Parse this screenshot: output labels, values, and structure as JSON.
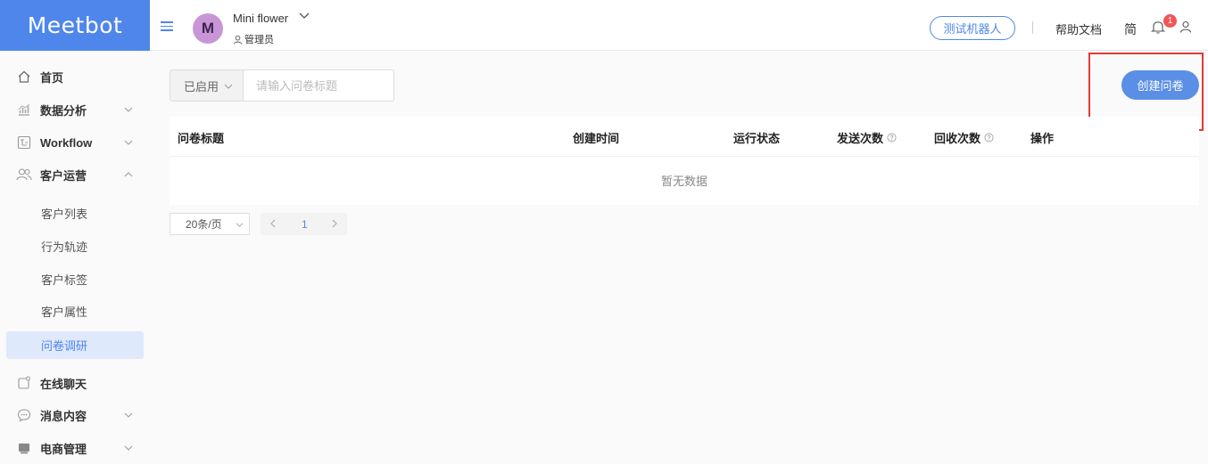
{
  "app": {
    "logo_text": "Meetbot"
  },
  "colors": {
    "brand": "#4f86ec",
    "active_bg": "#dfe9fc",
    "highlight": "#e53935",
    "badge": "#f25555"
  },
  "topbar": {
    "avatar_letter": "M",
    "org_name": "Mini flower",
    "role": "管理员",
    "test_bot_label": "测试机器人",
    "help_label": "帮助文档",
    "lang_label": "简",
    "notification_count": "1"
  },
  "sidebar": {
    "items": [
      {
        "label": "首页",
        "icon": "home-icon"
      },
      {
        "label": "数据分析",
        "icon": "analytics-icon"
      },
      {
        "label": "Workflow",
        "icon": "workflow-icon"
      },
      {
        "label": "客户运营",
        "icon": "users-icon"
      },
      {
        "label": "在线聊天",
        "icon": "chat-icon"
      },
      {
        "label": "消息内容",
        "icon": "message-icon"
      },
      {
        "label": "电商管理",
        "icon": "store-icon"
      }
    ],
    "sub_items": [
      {
        "label": "客户列表"
      },
      {
        "label": "行为轨迹"
      },
      {
        "label": "客户标签"
      },
      {
        "label": "客户属性"
      },
      {
        "label": "问卷调研"
      }
    ]
  },
  "main": {
    "status_filter": "已启用",
    "search_placeholder": "请输入问卷标题",
    "create_button": "创建问卷",
    "table": {
      "columns": [
        "问卷标题",
        "创建时间",
        "运行状态",
        "发送次数",
        "回收次数",
        "操作"
      ],
      "empty_text": "暂无数据"
    },
    "pagination": {
      "page_size": "20条/页",
      "current_page": "1"
    }
  }
}
